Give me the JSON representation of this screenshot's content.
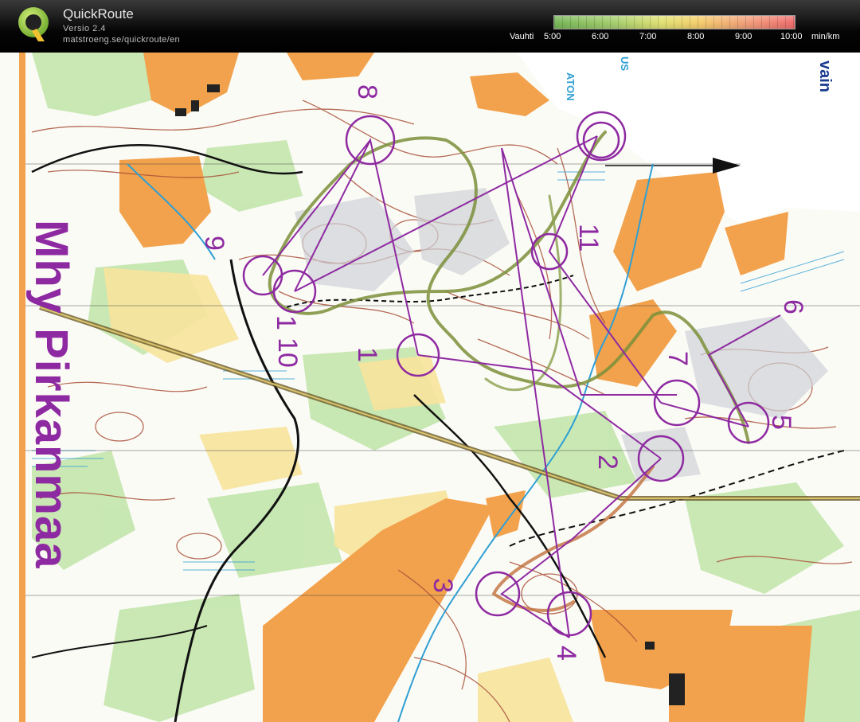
{
  "app": {
    "title": "QuickRoute",
    "version": "Versio 2.4",
    "url": "matstroeng.se/quickroute/en"
  },
  "pace_legend": {
    "label": "Vauhti",
    "ticks": [
      "5:00",
      "6:00",
      "7:00",
      "8:00",
      "9:00",
      "10:00"
    ],
    "unit": "min/km",
    "colors": [
      "#79b75a",
      "#a6cf6f",
      "#e3e275",
      "#f5cf6e",
      "#f2a07c",
      "#ef6e6e"
    ]
  },
  "map": {
    "region_label": "Mhy Pirkanmaa",
    "partial_labels": [
      "vain",
      "ATON",
      "US"
    ],
    "control_numbers": [
      "1",
      "2",
      "3",
      "4",
      "5",
      "6",
      "7",
      "8",
      "9",
      "10",
      "11"
    ],
    "colors": {
      "course": "#8e2aa1",
      "route": "#7b8f3a",
      "open_land": "#f2a24c",
      "green": "#a7d98c",
      "contour": "#a9523a",
      "water": "#2f9fd3"
    }
  }
}
